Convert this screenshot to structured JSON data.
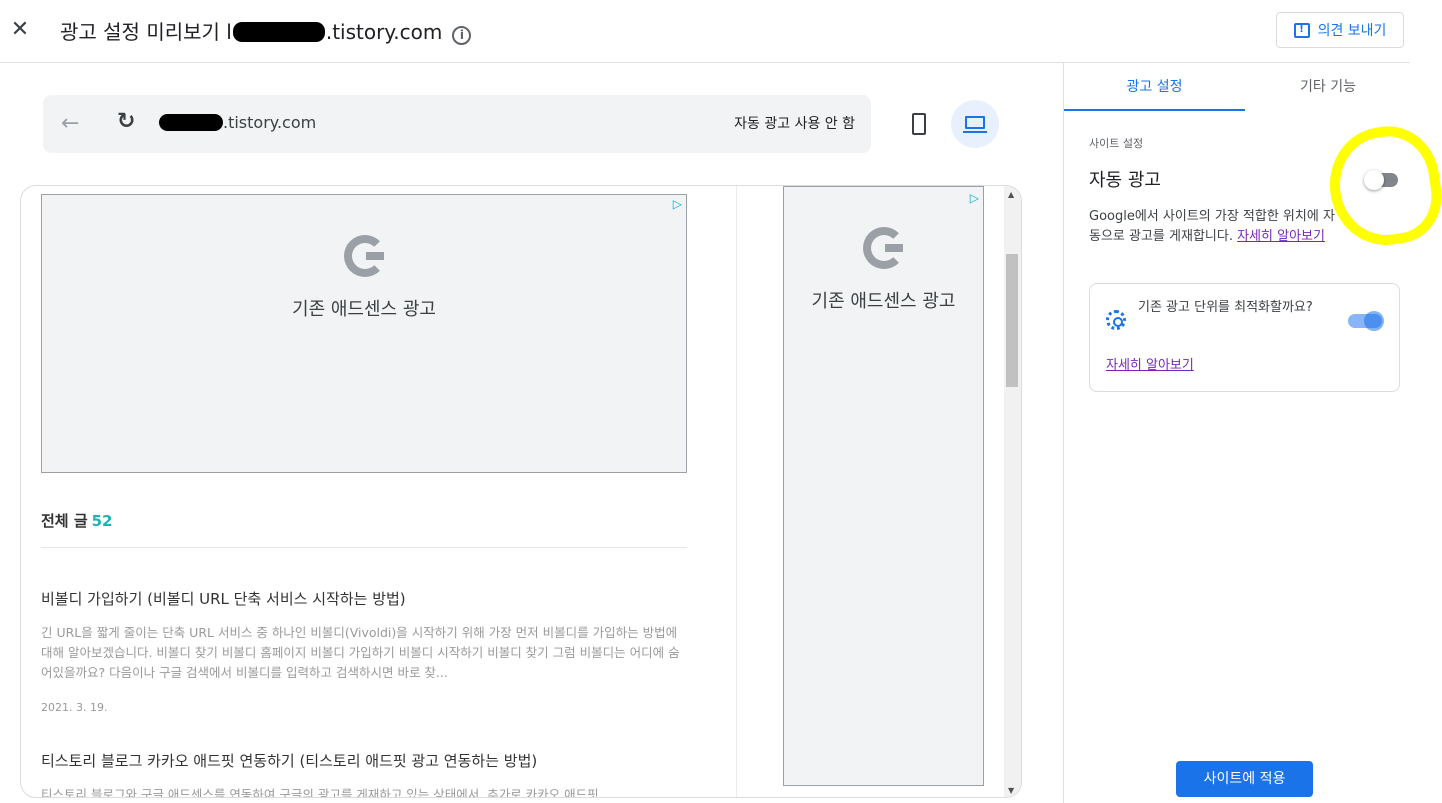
{
  "header": {
    "title_prefix": "광고 설정 미리보기 l",
    "title_domain": ".tistory.com",
    "info_icon": "ⓘ",
    "feedback_label": "의견 보내기"
  },
  "browser": {
    "url_suffix": ".tistory.com",
    "auto_ads_status": "자동 광고 사용 안 함"
  },
  "preview": {
    "ad_left_label": "기존 애드센스 광고",
    "ad_right_label": "기존 애드센스 광고",
    "post_count_label": "전체 글",
    "post_count_value": "52",
    "posts": [
      {
        "title": "비볼디 가입하기 (비볼디 URL 단축 서비스 시작하는 방법)",
        "excerpt": "긴 URL을 짧게 줄이는 단축 URL 서비스 중 하나인 비볼디(Vivoldi)을 시작하기 위해 가장 먼저 비볼디를 가입하는 방법에 대해 알아보겠습니다. 비볼디 찾기 비볼디 홈페이지 비볼디 가입하기 비볼디 시작하기 비볼디 찾기 그럼 비볼디는 어디에 숨어있을까요? 다음이나 구글 검색에서 비볼디를 입력하고 검색하시면 바로 찾...",
        "date": "2021. 3. 19."
      },
      {
        "title": "티스토리 블로그 카카오 애드핏 연동하기 (티스토리 애드핏 광고 연동하는 방법)",
        "excerpt": "티스토리 블로그와 구글 애드센스를 연동하여 구글의 광고를 게재하고 있는 상태에서, 추가로 카카오 애드핏"
      }
    ]
  },
  "panel": {
    "tabs": [
      "광고 설정",
      "기타 기능"
    ],
    "section_label": "사이트 설정",
    "auto_ads_title": "자동 광고",
    "auto_ads_enabled": false,
    "description": "Google에서 사이트의 가장 적합한 위치에 자동으로 광고를 게재합니다. ",
    "learn_more": "자세히 알아보기",
    "optimize_question": "기존 광고 단위를 최적화할까요?",
    "optimize_enabled": true,
    "optimize_learn_more": "자세히 알아보기",
    "apply_button": "사이트에 적용"
  },
  "colors": {
    "accent": "#1a73e8",
    "link_visited": "#7627bb",
    "highlight": "#ffff00",
    "count": "#1db3b3"
  }
}
